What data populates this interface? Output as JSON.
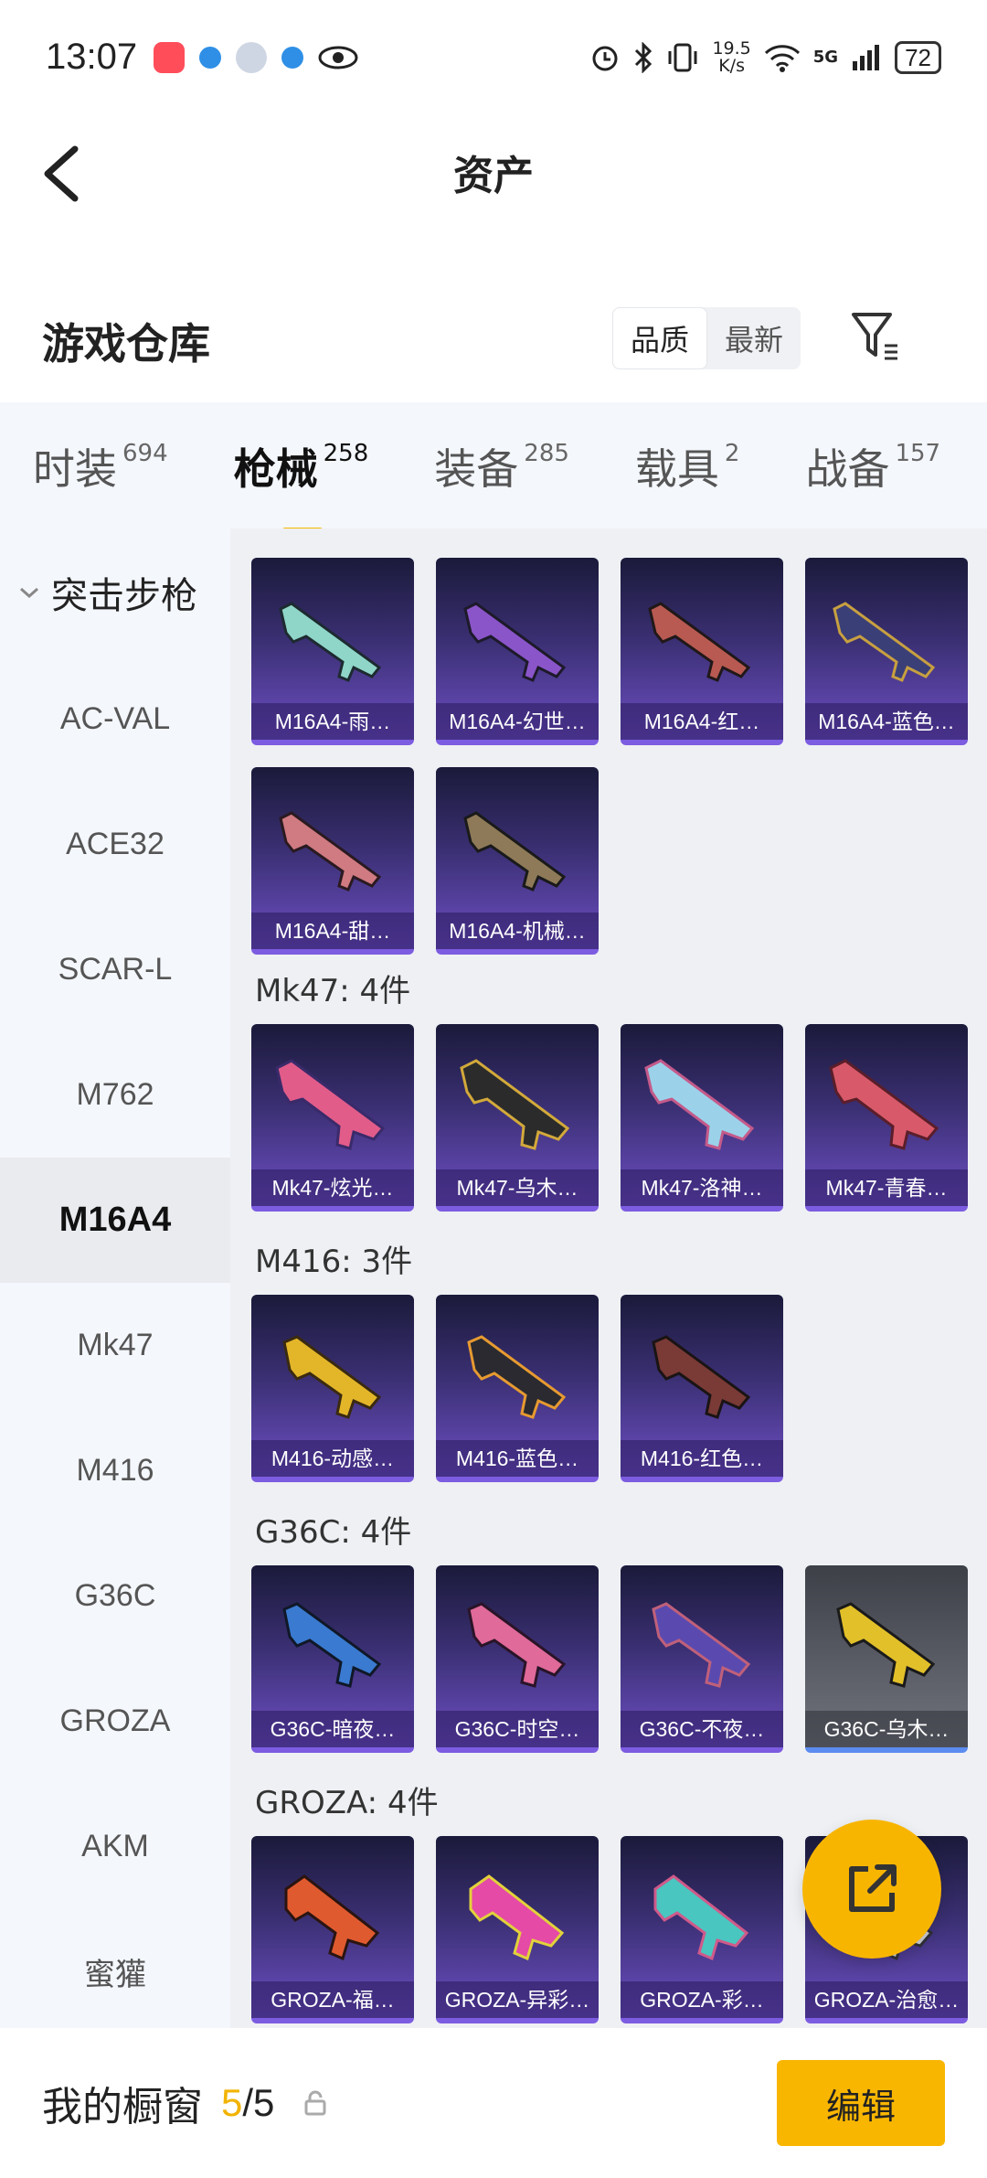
{
  "status_bar": {
    "time": "13:07",
    "net_speed_value": "19.5",
    "net_speed_unit": "K/s",
    "network": "5G",
    "battery": "72"
  },
  "nav": {
    "title": "资产"
  },
  "warehouse": {
    "title": "游戏仓库",
    "sort_options": [
      "品质",
      "最新"
    ],
    "active_sort": "品质"
  },
  "tabs": [
    {
      "label": "时装",
      "count": "694"
    },
    {
      "label": "枪械",
      "count": "258",
      "active": true
    },
    {
      "label": "装备",
      "count": "285"
    },
    {
      "label": "载具",
      "count": "2"
    },
    {
      "label": "战备",
      "count": "157"
    }
  ],
  "sidebar": {
    "group": "突击步枪",
    "items": [
      "AC-VAL",
      "ACE32",
      "SCAR-L",
      "M762",
      "M16A4",
      "Mk47",
      "M416",
      "G36C",
      "GROZA",
      "AKM",
      "蜜獾"
    ],
    "active": "M16A4"
  },
  "sections": {
    "m16a4": {
      "items": [
        "M16A4-雨…",
        "M16A4-幻世…",
        "M16A4-红…",
        "M16A4-蓝色…",
        "M16A4-甜…",
        "M16A4-机械…"
      ]
    },
    "mk47": {
      "header": "Mk47: 4件",
      "items": [
        "Mk47-炫光…",
        "Mk47-乌木…",
        "Mk47-洛神…",
        "Mk47-青春…"
      ]
    },
    "m416": {
      "header": "M416: 3件",
      "items": [
        "M416-动感…",
        "M416-蓝色…",
        "M416-红色…"
      ]
    },
    "g36c": {
      "header": "G36C: 4件",
      "items": [
        "G36C-暗夜…",
        "G36C-时空…",
        "G36C-不夜…",
        "G36C-乌木…"
      ]
    },
    "groza": {
      "header": "GROZA: 4件",
      "items": [
        "GROZA-福…",
        "GROZA-异彩…",
        "GROZA-彩…",
        "GROZA-治愈…"
      ]
    }
  },
  "bottom": {
    "label": "我的橱窗",
    "used": "5",
    "total": "/5",
    "edit_label": "编辑"
  },
  "colors": {
    "accent": "#f8b500",
    "card_top": "#1a1a3a",
    "card_bottom": "#6d4fc4",
    "sidebar_bg": "#f4f7fc"
  }
}
